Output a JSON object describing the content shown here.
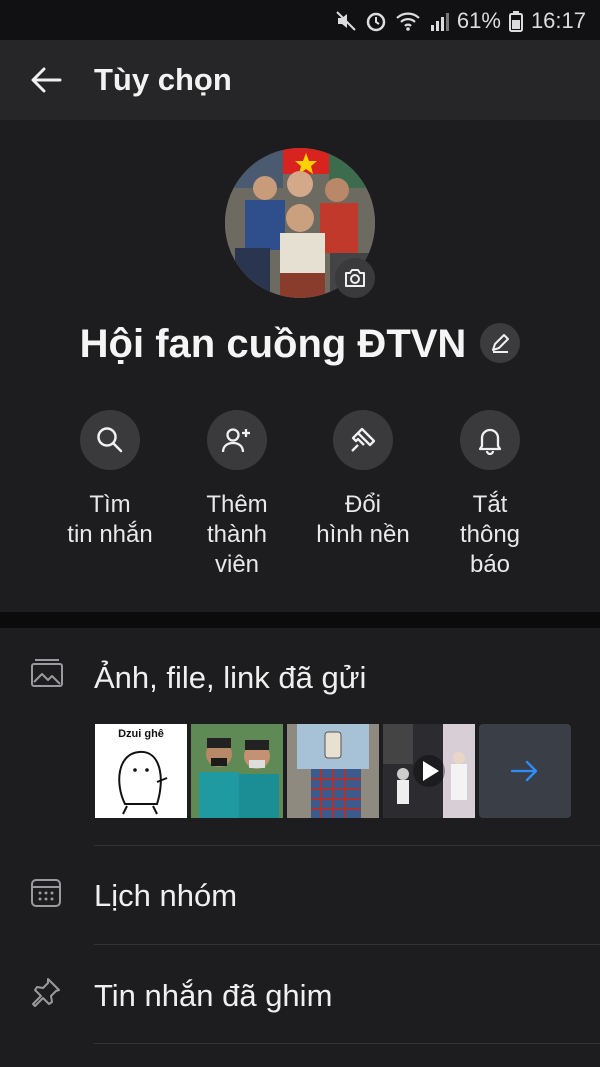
{
  "status": {
    "battery": "61%",
    "time": "16:17"
  },
  "header": {
    "title": "Tùy chọn"
  },
  "group": {
    "name": "Hội fan cuồng ĐTVN"
  },
  "actions": [
    {
      "line1": "Tìm",
      "line2": "tin nhắn",
      "line3": ""
    },
    {
      "line1": "Thêm",
      "line2": "thành",
      "line3": "viên"
    },
    {
      "line1": "Đổi",
      "line2": "hình nền",
      "line3": ""
    },
    {
      "line1": "Tắt",
      "line2": "thông",
      "line3": "báo"
    }
  ],
  "sections": {
    "media_label": "Ảnh, file, link đã gửi",
    "thumb1_caption": "Dzui ghê",
    "calendar_label": "Lịch nhóm",
    "pinned_label": "Tin nhắn đã ghim"
  },
  "colors": {
    "accent": "#2f8cff",
    "background": "#1d1d1f",
    "appbar": "#262628"
  }
}
